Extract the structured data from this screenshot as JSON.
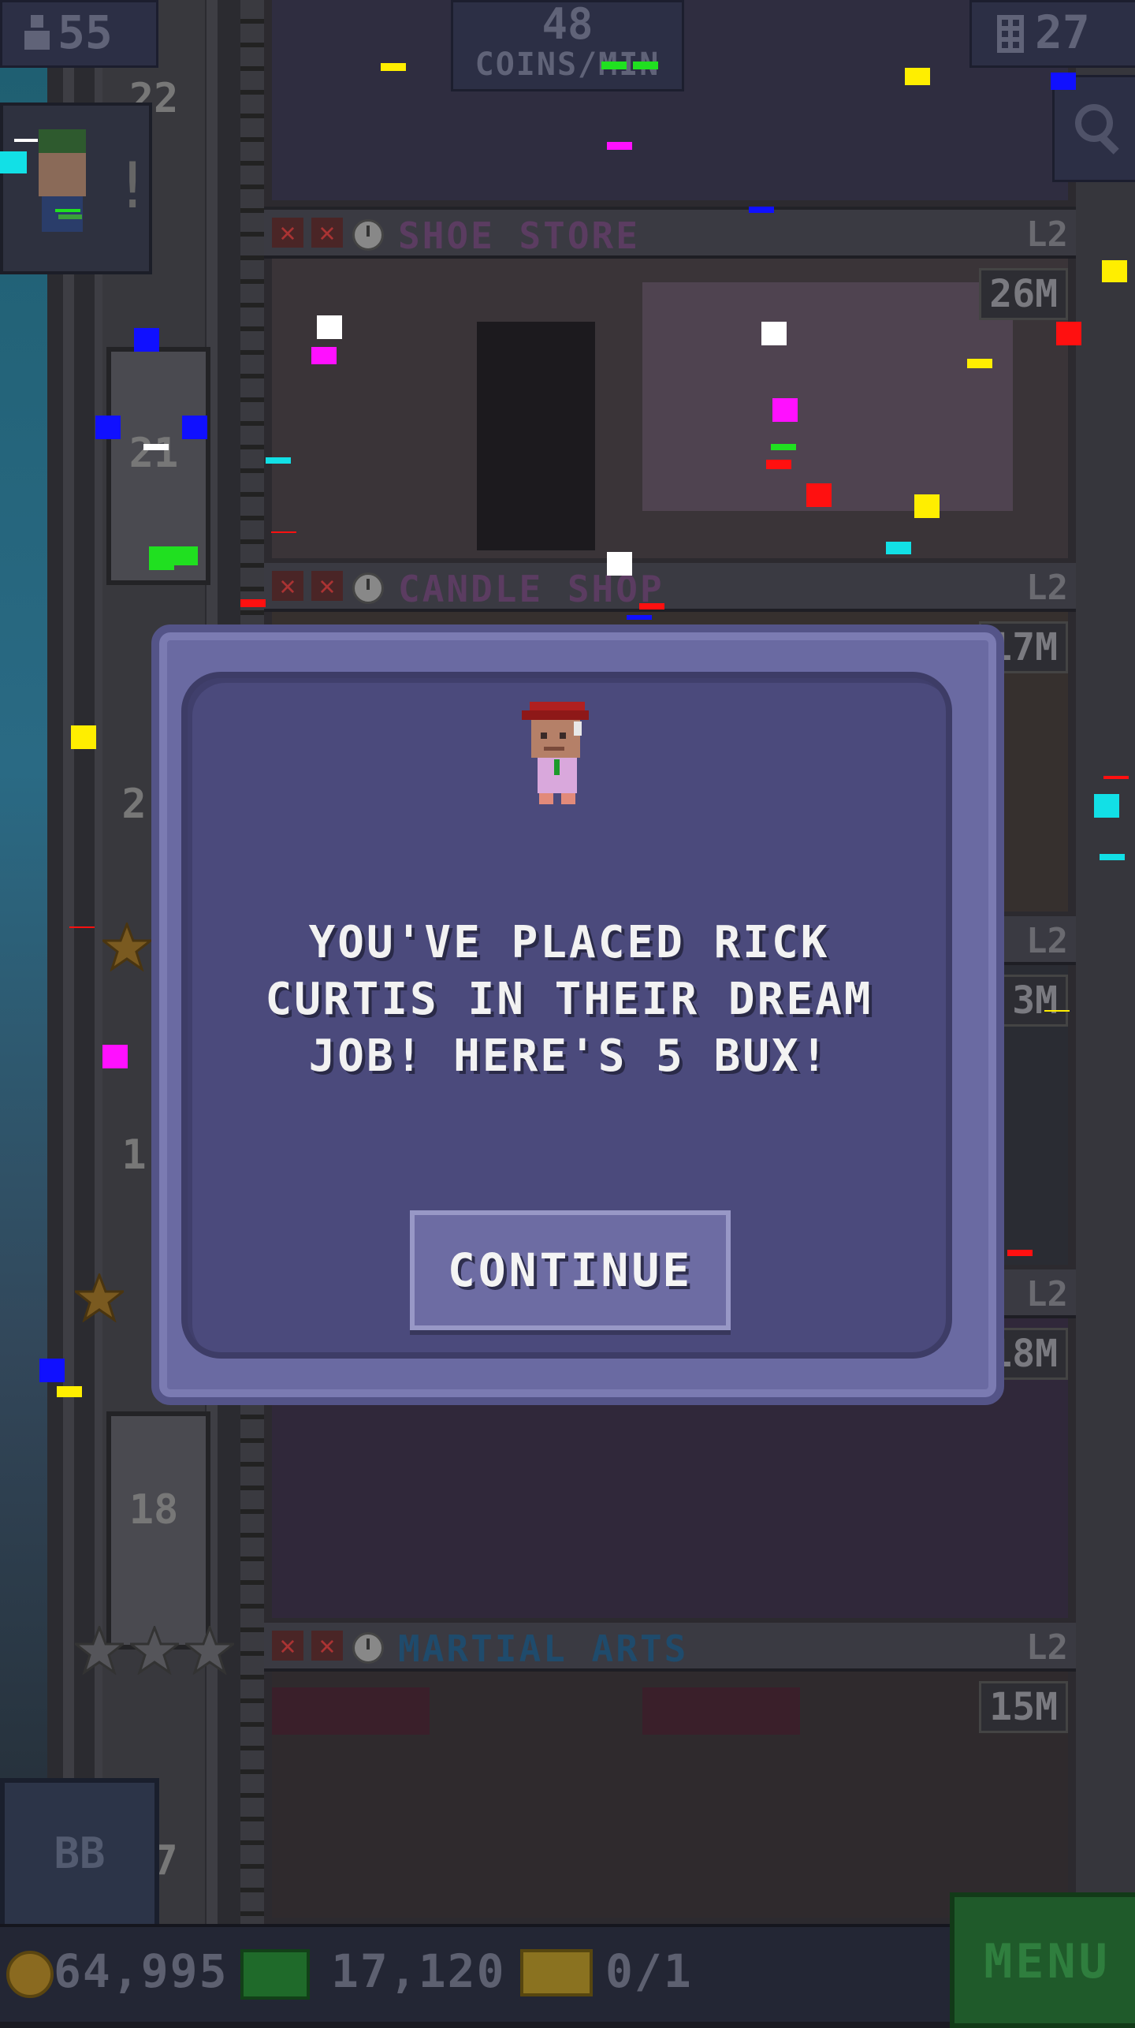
{
  "hud": {
    "population": "55",
    "coins_rate_value": "48",
    "coins_rate_label": "COINS/MIN",
    "floors_count": "27"
  },
  "floors": [
    {
      "name": "SHOE STORE",
      "level": "L2",
      "cost": "26M",
      "name_color": "#5b3c61"
    },
    {
      "name": "CANDLE SHOP",
      "level": "L2",
      "cost": "17M",
      "name_color": "#5b3c61"
    },
    {
      "name": "MARTIAL ARTS",
      "level": "L2",
      "cost": "15M",
      "name_color": "#1f4b6c"
    }
  ],
  "hidden_floor_levels": [
    "L2",
    "L2"
  ],
  "hidden_floor_costs": [
    "3M",
    "18M"
  ],
  "elevator_floor_numbers": [
    "22",
    "21",
    "2",
    "1",
    "18",
    "7"
  ],
  "modal": {
    "message": "YOU'VE PLACED RICK CURTIS IN THEIR DREAM JOB! HERE'S 5 BUX!",
    "continue_label": "CONTINUE"
  },
  "bottom": {
    "coins": "64,995",
    "bux": "17,120",
    "tickets": "0/1",
    "menu_label": "MENU",
    "bb_label": "BB"
  },
  "colors": {
    "modal_bg": "#4b4a7c",
    "modal_frame": "#6a6aa2",
    "button_bg": "#6d6ca3",
    "menu_green": "#1f5a2a"
  },
  "icons": [
    "person-icon",
    "building-icon",
    "search-icon",
    "x-icon",
    "clock-icon",
    "coin-icon",
    "bux-icon",
    "ticket-icon",
    "star-icon"
  ]
}
